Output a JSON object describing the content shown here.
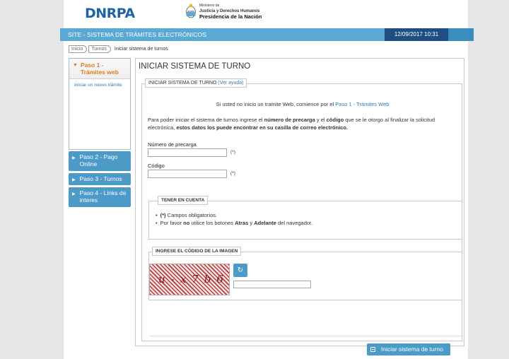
{
  "header": {
    "logo": "DNRPA",
    "ministry_line1": "Ministerio de",
    "ministry_line2": "Justicia y Derechos Humanos",
    "ministry_line3": "Presidencia de la Nación"
  },
  "topbar": {
    "title": "SITE - SISTEMA DE TRÁMITES ELECTRÓNICOS",
    "datetime": "12/09/2017 10:31"
  },
  "breadcrumb": {
    "items": [
      "Inicio",
      "Turnos"
    ],
    "current": "Iniciar sistema de turnos"
  },
  "sidebar": {
    "active_step": {
      "label": "Paso 1 - Trámites web",
      "link": "Iniciar un nuevo trámite"
    },
    "steps": [
      {
        "label": "Paso 2 - Pago Online"
      },
      {
        "label": "Paso 3 - Turnos"
      },
      {
        "label": "Paso 4 - Links de interes"
      }
    ]
  },
  "main": {
    "title": "INICIAR SISTEMA DE TURNO",
    "legend": "INICIAR SISTEMA DE TURNO",
    "help_link": "(Ver ayuda)",
    "intro_prefix": "Si usted no inicio un tramite Web, comience por el",
    "intro_link": "Paso 1 - Trámites Web",
    "instructions_a": "Para poder iniciar el sistema de turnos ingrese el ",
    "instructions_b": "número de precarga",
    "instructions_c": " y el ",
    "instructions_d": "código",
    "instructions_e": " que se le otorgo al finalizar la solicitud electrónica, ",
    "instructions_f": "estos datos los puede encontrar en su casilla de correo electrónico.",
    "field_precarga_label": "Número de precarga",
    "field_codigo_label": "Código",
    "required_mark": "(*)",
    "tener_legend": "TENER EN CUENTA",
    "tener_item1_a": "(*)",
    "tener_item1_b": " Campos obligatorios.",
    "tener_item2_a": "Por favor ",
    "tener_item2_b": "no",
    "tener_item2_c": " utilice los botones ",
    "tener_item2_d": "Atras",
    "tener_item2_e": " y ",
    "tener_item2_f": "Adelante",
    "tener_item2_g": " del navegador.",
    "captcha_legend": "INGRESE EL CÓDIGO DE LA IMAGEN",
    "captcha_text": "u-x7b6",
    "refresh_icon": "refresh-icon",
    "submit_label": "Iniciar sistema de turno"
  },
  "colors": {
    "brand": "#1f64a6",
    "topbar": "#5aa9d4",
    "date_bg": "#1f4f82",
    "step_orange": "#e07b1f",
    "button": "#4b9ac8"
  }
}
